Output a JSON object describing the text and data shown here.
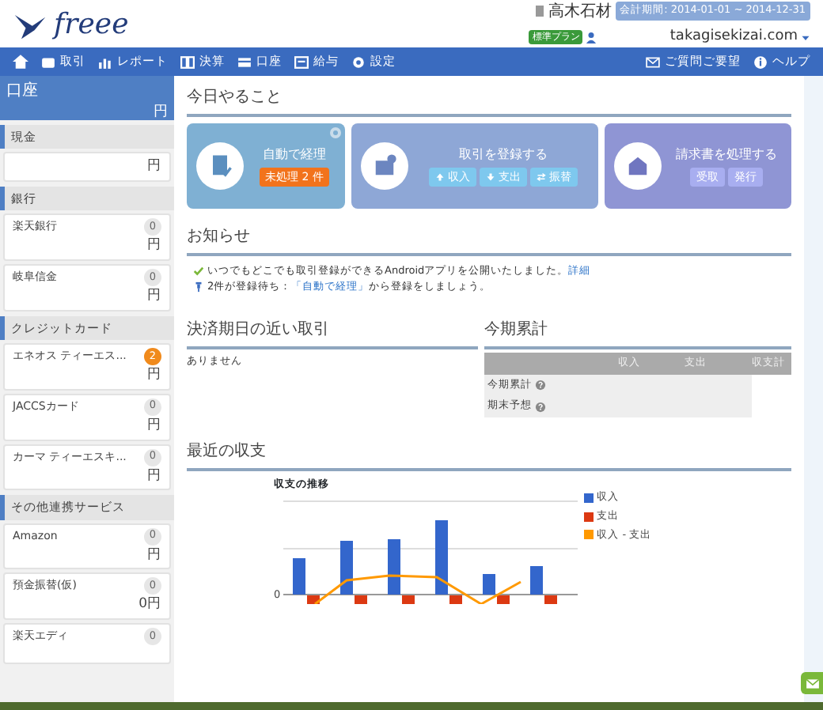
{
  "header": {
    "logo": "freee",
    "company": "高木石材",
    "period": "会計期間: 2014-01-01 ~ 2014-12-31",
    "plan": "標準プラン",
    "email": "takagisekizai.com"
  },
  "nav_left": [
    "取引",
    "レポート",
    "決算",
    "口座",
    "給与",
    "設定"
  ],
  "nav_right": [
    "ご質問ご要望",
    "ヘルプ"
  ],
  "sidebar": {
    "title": "口座",
    "amount": "円",
    "sections": [
      {
        "title": "現金",
        "accounts": [
          {
            "amount": "円"
          }
        ]
      },
      {
        "title": "銀行",
        "accounts": [
          {
            "name": "楽天銀行",
            "amount": "円",
            "count": "0",
            "alert": false
          },
          {
            "name": "岐阜信金",
            "amount": "円",
            "count": "0",
            "alert": false
          }
        ]
      },
      {
        "title": "クレジットカード",
        "accounts": [
          {
            "name": "エネオス ティーエス...",
            "amount": "円",
            "count": "2",
            "alert": true
          },
          {
            "name": "JACCSカード",
            "amount": "円",
            "count": "0",
            "alert": false
          },
          {
            "name": "カーマ ティーエスキ...",
            "amount": "円",
            "count": "0",
            "alert": false
          }
        ]
      },
      {
        "title": "その他連携サービス",
        "accounts": [
          {
            "name": "Amazon",
            "amount": "円",
            "count": "0",
            "alert": false
          },
          {
            "name": "預金振替(仮)",
            "amount": "0円",
            "count": "0",
            "alert": false
          },
          {
            "name": "楽天エディ",
            "count": "0",
            "alert": false
          }
        ]
      }
    ]
  },
  "todo": {
    "title": "今日やること",
    "cards": [
      {
        "kind": "auto",
        "title": "自動で経理",
        "buttons": [
          "未処理 2 件"
        ]
      },
      {
        "kind": "register",
        "title": "取引を登録する",
        "buttons": [
          "収入",
          "支出",
          "振替"
        ]
      },
      {
        "kind": "invoice",
        "title": "請求書を処理する",
        "buttons": [
          "受取",
          "発行"
        ]
      }
    ]
  },
  "notices": {
    "title": "お知らせ",
    "items": [
      {
        "kind": "check",
        "before": "いつでもどこでも取引登録ができるAndroidアプリを公開いたしました。",
        "link": "詳細"
      },
      {
        "kind": "pin",
        "before": "2件が登録待ち：",
        "link": "「自動で経理」",
        "after": "から登録をしましょう。"
      }
    ]
  },
  "due": {
    "title": "決済期日の近い取引",
    "empty": "ありません"
  },
  "summary": {
    "title": "今期累計",
    "columns": [
      "収入",
      "支出",
      "収支計"
    ],
    "rows": [
      "今期累計",
      "期末予想"
    ]
  },
  "recent": {
    "title": "最近の収支",
    "chart_title": "収支の推移",
    "y_tick": "0",
    "legend": [
      {
        "name": "収入",
        "color": "#3366cc"
      },
      {
        "name": "支出",
        "color": "#dc3912"
      },
      {
        "name": "収入 - 支出",
        "color": "#ff9900"
      }
    ]
  }
}
